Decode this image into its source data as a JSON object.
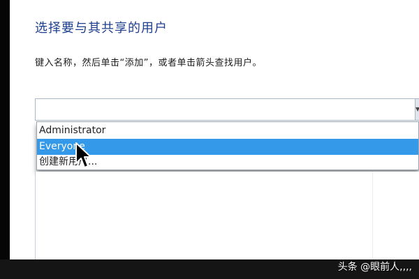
{
  "dialog": {
    "heading": "选择要与其共享的用户",
    "instruction": "键入名称，然后单击“添加”，或者单击箭头查找用户。",
    "combo": {
      "value": "",
      "arrow_icon": "dropdown-arrow-icon"
    },
    "dropdown": {
      "options": [
        "Administrator",
        "Everyone",
        "创建新用户..."
      ],
      "highlighted_index": 1
    }
  },
  "cursor": {
    "icon": "mouse-pointer-icon"
  },
  "watermark": {
    "text": "头条 @眼前人,,,,"
  },
  "colors": {
    "heading": "#1e3f8f",
    "highlight": "#3399e8",
    "border": "#a9b7c6"
  }
}
